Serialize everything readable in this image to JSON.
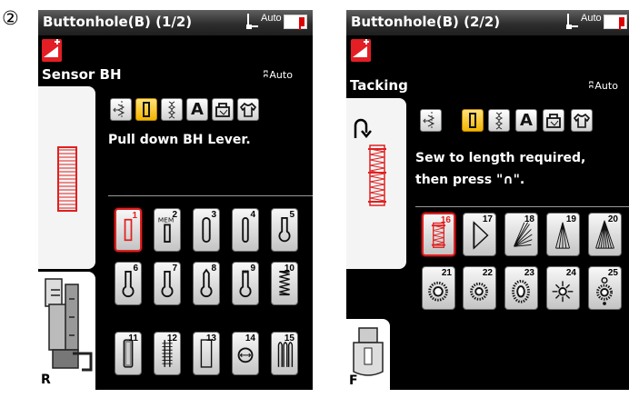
{
  "step_marker": "②",
  "screen1": {
    "title": "Buttonhole(B) (1/2)",
    "tension_label": "Auto",
    "mode_label": "Sensor BH",
    "auto_label": "Auto",
    "message": "Pull down BH Lever.",
    "foot_letter": "R",
    "tool_icons": [
      "tie-off-icon",
      "buttonhole-icon",
      "decorative-icon",
      "letter-a-icon",
      "bag-icon",
      "shirt-icon"
    ],
    "selected_tool": 1,
    "patterns": [
      {
        "num": "1",
        "icon": "square-buttonhole",
        "selected": true
      },
      {
        "num": "2",
        "icon": "mem-buttonhole",
        "label": "MEM"
      },
      {
        "num": "3",
        "icon": "round-buttonhole"
      },
      {
        "num": "4",
        "icon": "round-buttonhole-narrow"
      },
      {
        "num": "5",
        "icon": "keyhole-buttonhole"
      },
      {
        "num": "6",
        "icon": "keyhole-buttonhole"
      },
      {
        "num": "7",
        "icon": "keyhole-buttonhole"
      },
      {
        "num": "8",
        "icon": "keyhole-tapered"
      },
      {
        "num": "9",
        "icon": "keyhole-bartack"
      },
      {
        "num": "10",
        "icon": "stretch-buttonhole"
      },
      {
        "num": "11",
        "icon": "antique-buttonhole"
      },
      {
        "num": "12",
        "icon": "bound-buttonhole"
      },
      {
        "num": "13",
        "icon": "welted-buttonhole"
      },
      {
        "num": "14",
        "icon": "eyelet-circle"
      },
      {
        "num": "15",
        "icon": "heirloom-buttonhole"
      }
    ]
  },
  "screen2": {
    "title": "Buttonhole(B) (2/2)",
    "tension_label": "Auto",
    "mode_label": "Tacking",
    "auto_label": "Auto",
    "message_line1": "Sew to length required,",
    "message_line2": "then press",
    "message_quote": "\"∩\".",
    "foot_letter": "F",
    "tool_icons": [
      "tie-off-icon",
      "buttonhole-icon",
      "decorative-icon",
      "letter-a-icon",
      "bag-icon",
      "shirt-icon"
    ],
    "selected_tool": 1,
    "patterns": [
      {
        "num": "16",
        "icon": "tacking-zigzag",
        "selected": true
      },
      {
        "num": "17",
        "icon": "triangle-outline"
      },
      {
        "num": "18",
        "icon": "fan-stitch"
      },
      {
        "num": "19",
        "icon": "triangle-fill"
      },
      {
        "num": "20",
        "icon": "triangle-fill-dense"
      },
      {
        "num": "21",
        "icon": "eyelet-sun"
      },
      {
        "num": "22",
        "icon": "eyelet-sun"
      },
      {
        "num": "23",
        "icon": "eyelet-oval"
      },
      {
        "num": "24",
        "icon": "eyelet-star"
      },
      {
        "num": "25",
        "icon": "eyelet-flower"
      }
    ]
  },
  "colors": {
    "accent": "#e31e24",
    "selected_tool": "#f3b400",
    "screen_bg": "#000000"
  }
}
